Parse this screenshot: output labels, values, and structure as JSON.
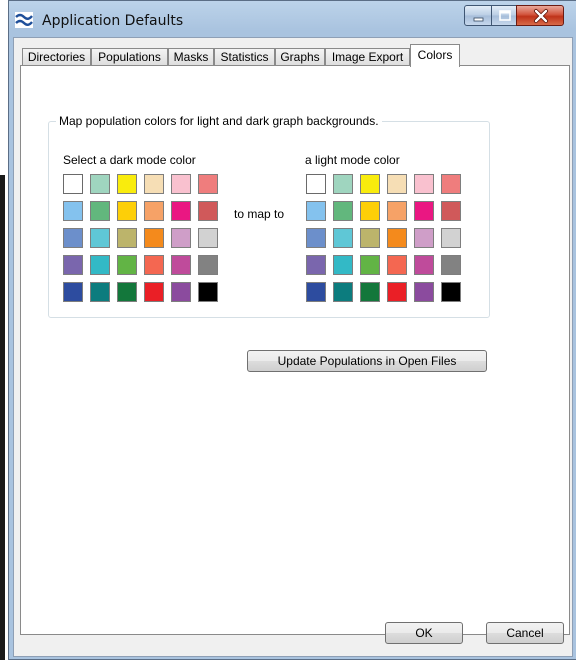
{
  "window": {
    "title": "Application Defaults",
    "icon": "waves-icon"
  },
  "title_controls": {
    "minimize": "minimize-icon",
    "maximize": "maximize-icon",
    "close": "close-icon"
  },
  "tabs": [
    {
      "label": "Directories"
    },
    {
      "label": "Populations"
    },
    {
      "label": "Masks"
    },
    {
      "label": "Statistics"
    },
    {
      "label": "Graphs"
    },
    {
      "label": "Image Export"
    },
    {
      "label": "Colors",
      "active": true
    }
  ],
  "colors_tab": {
    "group_title": "Map population colors for light and dark graph backgrounds.",
    "dark_label": "Select a dark mode color",
    "light_label": "a light mode color",
    "map_label": "to map to",
    "selected_dark": 0,
    "selected_light": 0,
    "palette": [
      [
        "#ffffff",
        "#9fd5bf",
        "#f9ec0d",
        "#f6deb5",
        "#f9c1cf",
        "#ef7d7d"
      ],
      [
        "#84c2ee",
        "#62b77d",
        "#fdcf08",
        "#f6a267",
        "#ea1782",
        "#d0595a"
      ],
      [
        "#6c8fcb",
        "#5fc7d6",
        "#bcb46b",
        "#f48a1c",
        "#cf9ec8",
        "#d2d2d2"
      ],
      [
        "#7a66ad",
        "#33b9c6",
        "#62b445",
        "#f46751",
        "#bf4b9b",
        "#828282"
      ],
      [
        "#2d4c9f",
        "#0c7c7e",
        "#13773b",
        "#ea1f26",
        "#8b4b9e",
        "#000000"
      ]
    ],
    "update_button": "Update Populations in Open Files"
  },
  "footer": {
    "ok": "OK",
    "cancel": "Cancel"
  }
}
